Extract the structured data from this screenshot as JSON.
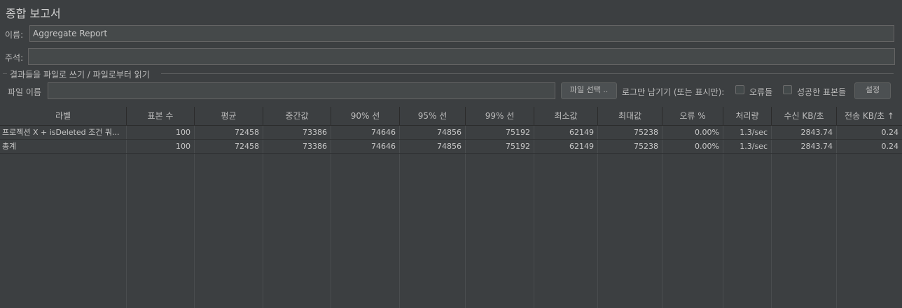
{
  "panel": {
    "title": "종합 보고서",
    "name_label": "이름:",
    "name_value": "Aggregate Report",
    "comment_label": "주석:",
    "comment_value": ""
  },
  "file_group": {
    "legend": "결과들을 파일로 쓰기 / 파일로부터 읽기",
    "file_label": "파일 이름",
    "file_value": "",
    "browse_button": "파일 선택 ..",
    "log_only_label": "로그만 남기기 (또는 표시만):",
    "errors_label": "오류들",
    "errors_checked": false,
    "successes_label": "성공한 표본들",
    "successes_checked": false,
    "settings_button": "설정"
  },
  "table": {
    "columns": [
      "라벨",
      "표본 수",
      "평균",
      "중간값",
      "90% 선",
      "95% 선",
      "99% 선",
      "최소값",
      "최대값",
      "오류 %",
      "처리량",
      "수신 KB/초",
      "전송 KB/초 ↑"
    ],
    "rows": [
      [
        "프로젝션 X + isDeleted 조건 쿼...",
        "100",
        "72458",
        "73386",
        "74646",
        "74856",
        "75192",
        "62149",
        "75238",
        "0.00%",
        "1.3/sec",
        "2843.74",
        "0.24"
      ],
      [
        "총계",
        "100",
        "72458",
        "73386",
        "74646",
        "74856",
        "75192",
        "62149",
        "75238",
        "0.00%",
        "1.3/sec",
        "2843.74",
        "0.24"
      ]
    ]
  }
}
